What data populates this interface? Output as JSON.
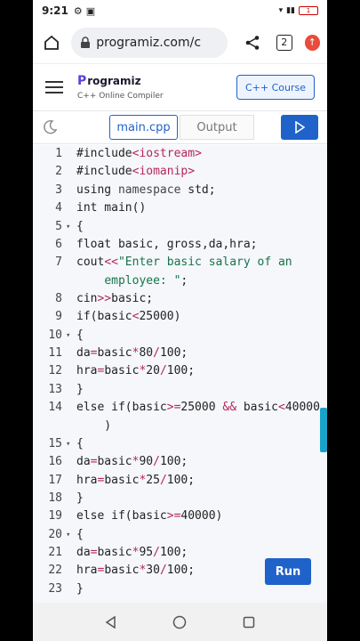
{
  "status": {
    "time": "9:21",
    "battery": "1"
  },
  "browser": {
    "url": "programiz.com/c",
    "tab_count": "2"
  },
  "site": {
    "logo_letter": "P",
    "logo_rest": "rogramiz",
    "subtitle": "C++ Online Compiler",
    "course_button": "C++ Course"
  },
  "toolbar": {
    "file_tab": "main.cpp",
    "output_tab": "Output"
  },
  "run_label": "Run",
  "code_lines": [
    {
      "n": "1",
      "fold": "",
      "html": "#include<span class='inc'>&lt;iostream&gt;</span>"
    },
    {
      "n": "2",
      "fold": "",
      "html": "#include<span class='inc'>&lt;iomanip&gt;</span>"
    },
    {
      "n": "3",
      "fold": "",
      "html": "using <span class='kw'>namespace</span> std;"
    },
    {
      "n": "4",
      "fold": "",
      "html": "int main()"
    },
    {
      "n": "5",
      "fold": "▾",
      "html": "{"
    },
    {
      "n": "6",
      "fold": "",
      "html": "float basic, gross,da,hra;"
    },
    {
      "n": "7",
      "fold": "",
      "html": "cout<span class='op'>&lt;&lt;</span><span class='str'>\"Enter basic salary of an</span>"
    },
    {
      "n": "",
      "fold": "",
      "html": "&nbsp;&nbsp;&nbsp;&nbsp;<span class='str'>employee: \"</span>;"
    },
    {
      "n": "8",
      "fold": "",
      "html": "cin<span class='op'>&gt;&gt;</span>basic;"
    },
    {
      "n": "9",
      "fold": "",
      "html": "if(basic<span class='op'>&lt;</span>25000)"
    },
    {
      "n": "10",
      "fold": "▾",
      "html": "{"
    },
    {
      "n": "11",
      "fold": "",
      "html": "da<span class='op'>=</span>basic<span class='op'>*</span>80<span class='op'>/</span>100;"
    },
    {
      "n": "12",
      "fold": "",
      "html": "hra<span class='op'>=</span>basic<span class='op'>*</span>20<span class='op'>/</span>100;"
    },
    {
      "n": "13",
      "fold": "",
      "html": "}"
    },
    {
      "n": "14",
      "fold": "",
      "html": "else if(basic<span class='op'>&gt;=</span>25000 <span class='op'>&amp;&amp;</span> basic<span class='op'>&lt;</span>40000"
    },
    {
      "n": "",
      "fold": "",
      "html": "&nbsp;&nbsp;&nbsp;&nbsp;)"
    },
    {
      "n": "15",
      "fold": "▾",
      "html": "{"
    },
    {
      "n": "16",
      "fold": "",
      "html": "da<span class='op'>=</span>basic<span class='op'>*</span>90<span class='op'>/</span>100;"
    },
    {
      "n": "17",
      "fold": "",
      "html": "hra<span class='op'>=</span>basic<span class='op'>*</span>25<span class='op'>/</span>100;"
    },
    {
      "n": "18",
      "fold": "",
      "html": "}"
    },
    {
      "n": "19",
      "fold": "",
      "html": "else if(basic<span class='op'>&gt;=</span>40000)"
    },
    {
      "n": "20",
      "fold": "▾",
      "html": "{"
    },
    {
      "n": "21",
      "fold": "",
      "html": "da<span class='op'>=</span>basic<span class='op'>*</span>95<span class='op'>/</span>100;"
    },
    {
      "n": "22",
      "fold": "",
      "html": "hra<span class='op'>=</span>basic<span class='op'>*</span>30<span class='op'>/</span>100;"
    },
    {
      "n": "23",
      "fold": "",
      "html": "}"
    }
  ],
  "colors": {
    "accent": "#1f62c9",
    "code_bg": "#f5f7fa",
    "scrollbar": "#1aa3c9"
  }
}
